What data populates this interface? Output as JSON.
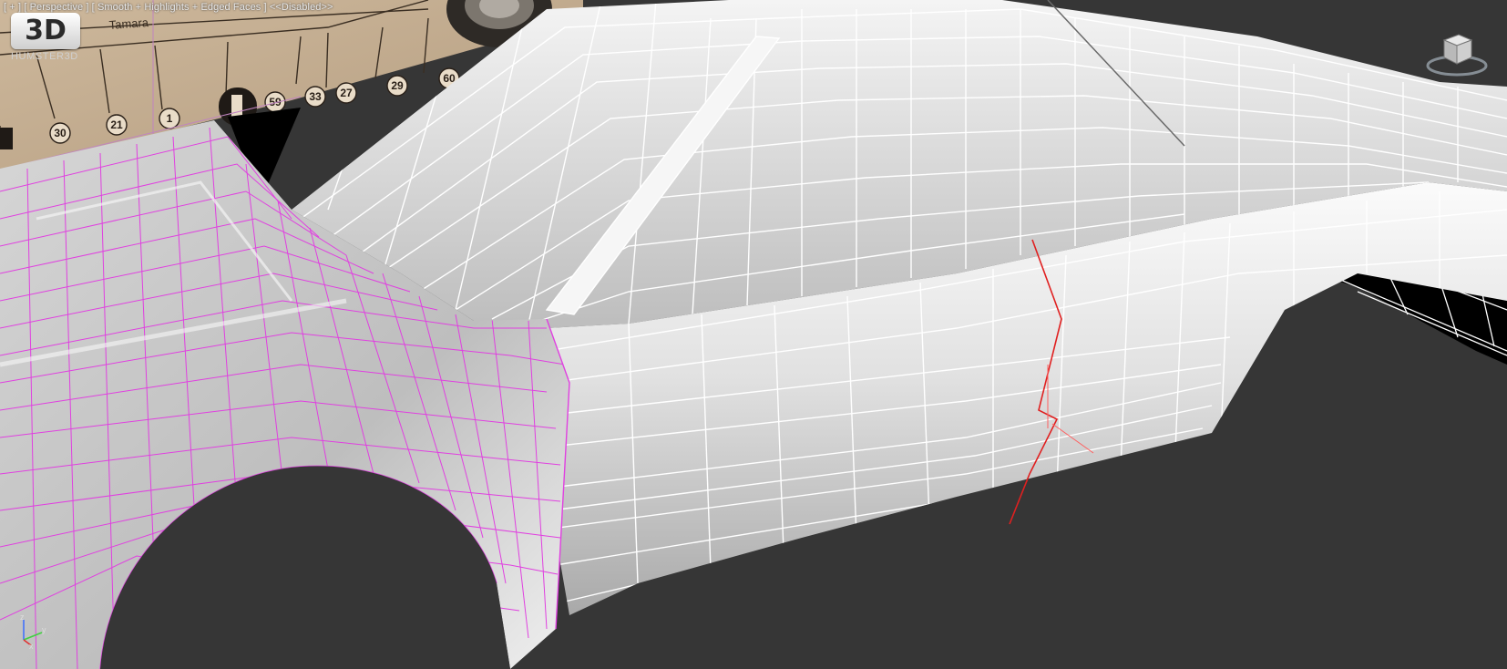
{
  "viewport": {
    "label_prefix": "[ + ]",
    "view_mode": "[ Perspective ]",
    "shading_mode": "[ Smooth + Highlights + Edged Faces ]",
    "status": "<<Disabled>>"
  },
  "watermark": {
    "logo_text": "3D",
    "brand": "HUMSTER3D"
  },
  "blueprint": {
    "callouts": [
      "30",
      "21",
      "1",
      "59",
      "33",
      "27",
      "29",
      "60"
    ],
    "plate_text": "Tamara"
  },
  "axis_gizmo": {
    "z": "z",
    "y": "y",
    "x": "x"
  },
  "colors": {
    "background": "#363636",
    "mesh_surface": "#d4d4d4",
    "wire_white": "#ffffff",
    "wire_selected": "#e040e0",
    "edge_highlight": "#e02020",
    "blueprint_paper": "#c8b49a"
  },
  "icons": [
    "viewcube-icon",
    "axis-gizmo-icon"
  ]
}
